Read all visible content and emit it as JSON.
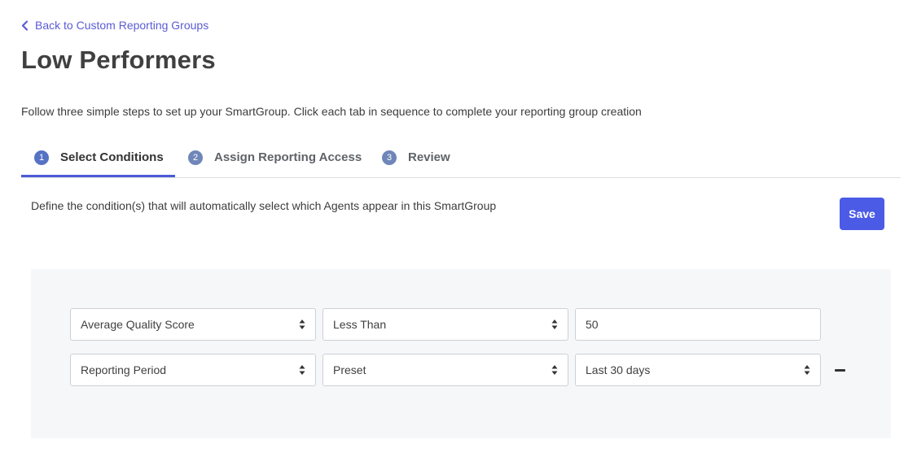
{
  "back_link": {
    "label": "Back to Custom Reporting Groups",
    "icon": "chevron-left-icon"
  },
  "page_title": "Low Performers",
  "intro_text": "Follow three simple steps to set up your SmartGroup. Click each tab in sequence to complete your reporting group creation",
  "tabs": [
    {
      "number": "1",
      "label": "Select Conditions",
      "active": true
    },
    {
      "number": "2",
      "label": "Assign Reporting Access",
      "active": false
    },
    {
      "number": "3",
      "label": "Review",
      "active": false
    }
  ],
  "conditions_section": {
    "description": "Define the condition(s) that will automatically select which Agents appear in this SmartGroup",
    "save_label": "Save",
    "rows": [
      {
        "field": "Average Quality Score",
        "operator": "Less Than",
        "value": "50",
        "value_type": "input"
      },
      {
        "field": "Reporting Period",
        "operator": "Preset",
        "value": "Last 30 days",
        "value_type": "select",
        "removable": true
      }
    ]
  },
  "colors": {
    "accent": "#4b5be6",
    "link": "#5b5bd6",
    "tab_underline": "#4a5bd6",
    "panel_bg": "#f6f7f9"
  }
}
